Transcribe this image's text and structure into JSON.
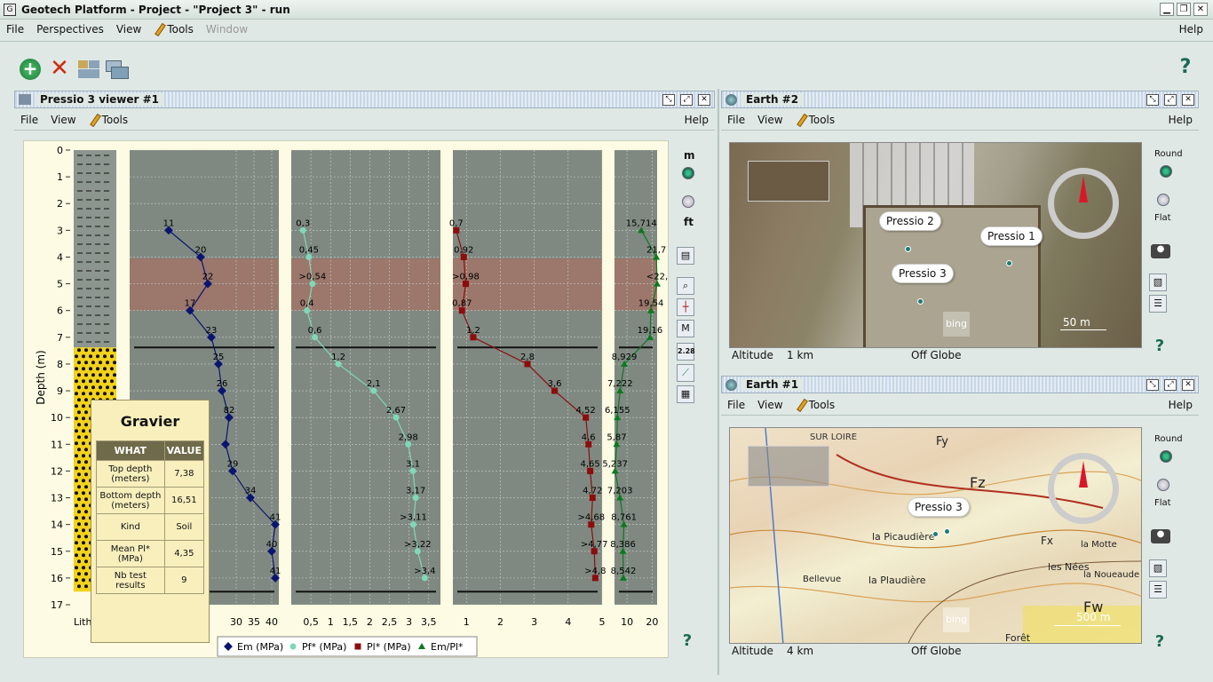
{
  "window": {
    "title": "Geotech Platform - Project - \"Project 3\" - run"
  },
  "main_menu": {
    "file": "File",
    "perspectives": "Perspectives",
    "view": "View",
    "tools": "Tools",
    "window": "Window",
    "help": "Help"
  },
  "icons": {
    "add": "add-icon",
    "delete": "delete-icon",
    "layout1": "layout-icon",
    "layout2": "cascade-icon",
    "help": "help-icon"
  },
  "pressio_panel": {
    "title": "Pressio 3 viewer #1",
    "menu": {
      "file": "File",
      "view": "View",
      "tools": "Tools",
      "help": "Help"
    },
    "unit_m": "m",
    "unit_ft": "ft",
    "depth_label": "Depth (m)",
    "lith_label": "Lith",
    "tool_value": "2.28",
    "tool_m": "M",
    "legend": {
      "em": "Em (MPa)",
      "pf": "Pf* (MPa)",
      "pl": "Pl* (MPa)",
      "empl": "Em/Pl*"
    },
    "tooltip": {
      "title": "Gravier",
      "col_what": "WHAT",
      "col_value": "VALUE",
      "rows": [
        {
          "what": "Top depth (meters)",
          "value": "7,38"
        },
        {
          "what": "Bottom depth (meters)",
          "value": "16,51"
        },
        {
          "what": "Kind",
          "value": "Soil"
        },
        {
          "what": "Mean Pl* (MPa)",
          "value": "4,35"
        },
        {
          "what": "Nb test results",
          "value": "9"
        }
      ]
    }
  },
  "chart_data": {
    "type": "line",
    "ylabel": "Depth (m)",
    "ylim": [
      0,
      17
    ],
    "y_ticks": [
      "0",
      "1",
      "2",
      "3",
      "4",
      "5",
      "6",
      "7",
      "8",
      "9",
      "10",
      "11",
      "12",
      "13",
      "14",
      "15",
      "16",
      "17"
    ],
    "tracks": [
      {
        "name": "Em (MPa)",
        "xlim": [
          0,
          42
        ],
        "x_ticks": [
          "30",
          "35",
          "40"
        ],
        "color": "#0a1470",
        "depth": [
          3,
          4,
          5,
          6,
          7,
          8,
          9,
          10,
          11,
          12,
          13,
          14,
          15,
          16
        ],
        "values": [
          11,
          20,
          22,
          17,
          23,
          25,
          26,
          28,
          27,
          29,
          34,
          41,
          40,
          41
        ],
        "labels": [
          "11",
          "20",
          "22",
          "17",
          "23",
          "25",
          "26",
          "82",
          "",
          "29",
          "34",
          "41",
          "40",
          "41"
        ]
      },
      {
        "name": "Pf* (MPa)",
        "xlim": [
          0,
          3.8
        ],
        "x_ticks": [
          "0,5",
          "1",
          "1,5",
          "2",
          "2,5",
          "3",
          "3,5"
        ],
        "color": "#7fd9b8",
        "depth": [
          3,
          4,
          5,
          6,
          7,
          8,
          9,
          10,
          11,
          12,
          13,
          14,
          15,
          16
        ],
        "values": [
          0.3,
          0.45,
          0.54,
          0.4,
          0.6,
          1.2,
          2.1,
          2.67,
          2.98,
          3.1,
          3.17,
          3.11,
          3.22,
          3.4
        ],
        "labels": [
          "0,3",
          "0,45",
          ">0,54",
          "0,4",
          "0,6",
          "1,2",
          "2,1",
          "2,67",
          "2,98",
          "3,1",
          "3,17",
          ">3,11",
          ">3,22",
          ">3,4"
        ]
      },
      {
        "name": "Pl* (MPa)",
        "xlim": [
          0.6,
          5
        ],
        "x_ticks": [
          "1",
          "2",
          "3",
          "4",
          "5"
        ],
        "color": "#8c0d0d",
        "depth": [
          3,
          4,
          5,
          6,
          7,
          8,
          9,
          10,
          11,
          12,
          13,
          14,
          15,
          16
        ],
        "values": [
          0.7,
          0.92,
          0.98,
          0.87,
          1.2,
          2.8,
          3.6,
          4.52,
          4.6,
          4.65,
          4.72,
          4.68,
          4.77,
          4.8
        ],
        "labels": [
          "0,7",
          "0,92",
          ">0,98",
          "0,87",
          "1,2",
          "2,8",
          "3,6",
          "4,52",
          "4,6",
          "4,65",
          "4,72",
          ">4,68",
          ">4,77",
          ">4,8"
        ]
      },
      {
        "name": "Em/Pl*",
        "xlim": [
          5,
          22
        ],
        "x_ticks": [
          "10",
          "20"
        ],
        "color": "#0a7a1f",
        "depth": [
          3,
          4,
          5,
          6,
          7,
          8,
          9,
          10,
          11,
          12,
          13,
          14,
          15,
          16
        ],
        "values": [
          15.714,
          21.7,
          22,
          19.54,
          19.16,
          8.929,
          7.222,
          6.155,
          5.87,
          5.237,
          7.203,
          8.761,
          8.386,
          8.542
        ],
        "labels": [
          "15,714",
          "21,7",
          "<22,",
          "19,54",
          "19,16",
          "8,929",
          "7,222",
          "6,155",
          "5,87",
          "5,237",
          "7,203",
          "8,761",
          "8,386",
          "8,542"
        ]
      }
    ],
    "highlight_band": [
      4.05,
      6.0
    ],
    "layer_boundaries": [
      7.38,
      16.51
    ],
    "lithology": [
      {
        "from": 0,
        "to": 7.38,
        "kind": "silt"
      },
      {
        "from": 7.38,
        "to": 16.51,
        "kind": "gravel"
      }
    ]
  },
  "earth2": {
    "title": "Earth #2",
    "menu": {
      "file": "File",
      "view": "View",
      "tools": "Tools",
      "help": "Help"
    },
    "markers": [
      "Pressio 2",
      "Pressio 1",
      "Pressio 3"
    ],
    "scale": "50 m",
    "provider": "bing",
    "round": "Round",
    "flat": "Flat",
    "altitude_label": "Altitude",
    "altitude_value": "1 km",
    "globe_status": "Off Globe"
  },
  "earth1": {
    "title": "Earth #1",
    "menu": {
      "file": "File",
      "view": "View",
      "tools": "Tools",
      "help": "Help"
    },
    "markers": [
      "Pressio 3"
    ],
    "map_labels": [
      "Fy",
      "Fz",
      "Fx",
      "Fw",
      "la Picaudière",
      "la Plaudière",
      "Bellevue",
      "Forêt",
      "les Nées",
      "la Motte",
      "la Noueaude",
      "SUR LOIRE"
    ],
    "scale": "500 m",
    "provider": "bing",
    "round": "Round",
    "flat": "Flat",
    "altitude_label": "Altitude",
    "altitude_value": "4 km",
    "globe_status": "Off Globe"
  }
}
